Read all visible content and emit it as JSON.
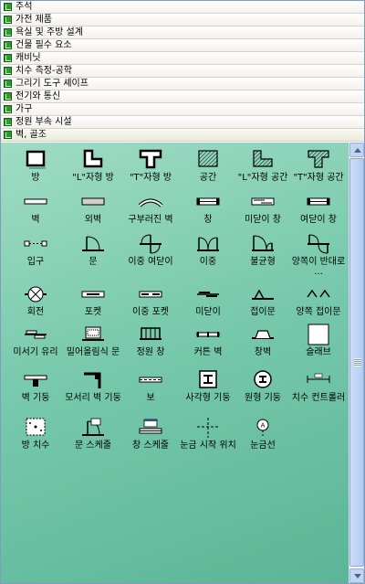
{
  "stencils": [
    {
      "label": "주석"
    },
    {
      "label": "가전 제품"
    },
    {
      "label": "욕실 및 주방 설계"
    },
    {
      "label": "건물 필수 요소"
    },
    {
      "label": "캐비닛"
    },
    {
      "label": "치수 측정-공학"
    },
    {
      "label": "그리기 도구 셰이프"
    },
    {
      "label": "전기와 통신"
    },
    {
      "label": "가구"
    },
    {
      "label": "정원 부속 시설"
    },
    {
      "label": "벽, 골조"
    }
  ],
  "shapes": [
    {
      "label": "방",
      "icon": "room-icon"
    },
    {
      "label": "\"L\"자형 방",
      "icon": "l-room-icon"
    },
    {
      "label": "\"T\"자형 방",
      "icon": "t-room-icon"
    },
    {
      "label": "공간",
      "icon": "space-icon"
    },
    {
      "label": "\"L\"자형 공간",
      "icon": "l-space-icon"
    },
    {
      "label": "\"T\"자형 공간",
      "icon": "t-space-icon"
    },
    {
      "label": "벽",
      "icon": "wall-icon"
    },
    {
      "label": "외벽",
      "icon": "exterior-wall-icon"
    },
    {
      "label": "구부러진 벽",
      "icon": "curved-wall-icon"
    },
    {
      "label": "창",
      "icon": "window-icon"
    },
    {
      "label": "미닫이 창",
      "icon": "sliding-window-icon"
    },
    {
      "label": "여닫이 창",
      "icon": "casement-window-icon"
    },
    {
      "label": "입구",
      "icon": "opening-icon"
    },
    {
      "label": "문",
      "icon": "door-icon"
    },
    {
      "label": "이중 여닫이",
      "icon": "double-swing-icon"
    },
    {
      "label": "이중",
      "icon": "double-door-icon"
    },
    {
      "label": "불균형",
      "icon": "uneven-door-icon"
    },
    {
      "label": "양쪽이 반대로 ...",
      "icon": "opposing-door-icon"
    },
    {
      "label": "회전",
      "icon": "revolving-door-icon"
    },
    {
      "label": "포켓",
      "icon": "pocket-door-icon"
    },
    {
      "label": "이중 포켓",
      "icon": "double-pocket-icon"
    },
    {
      "label": "미닫이",
      "icon": "sliding-door-icon"
    },
    {
      "label": "접이문",
      "icon": "bifold-door-icon"
    },
    {
      "label": "양쪽 접이문",
      "icon": "double-bifold-icon"
    },
    {
      "label": "미서기 유리",
      "icon": "sliding-glass-icon"
    },
    {
      "label": "밀어올림식 문",
      "icon": "overhead-door-icon"
    },
    {
      "label": "정원 창",
      "icon": "garden-window-icon"
    },
    {
      "label": "커튼 벽",
      "icon": "curtain-wall-icon"
    },
    {
      "label": "창벽",
      "icon": "bay-window-icon"
    },
    {
      "label": "슬래브",
      "icon": "slab-icon"
    },
    {
      "label": "벽 기둥",
      "icon": "pilaster-icon"
    },
    {
      "label": "모서리 벽 기둥",
      "icon": "corner-pilaster-icon"
    },
    {
      "label": "보",
      "icon": "beam-icon"
    },
    {
      "label": "사각형 기둥",
      "icon": "square-column-icon"
    },
    {
      "label": "원형 기둥",
      "icon": "round-column-icon"
    },
    {
      "label": "치수 컨트롤러",
      "icon": "dimension-controller-icon"
    },
    {
      "label": "방 치수",
      "icon": "room-dimension-icon"
    },
    {
      "label": "문 스케줄",
      "icon": "door-schedule-icon"
    },
    {
      "label": "창 스케줄",
      "icon": "window-schedule-icon"
    },
    {
      "label": "눈금 시작 위치",
      "icon": "grid-origin-icon"
    },
    {
      "label": "눈금선",
      "icon": "grid-line-icon"
    }
  ]
}
